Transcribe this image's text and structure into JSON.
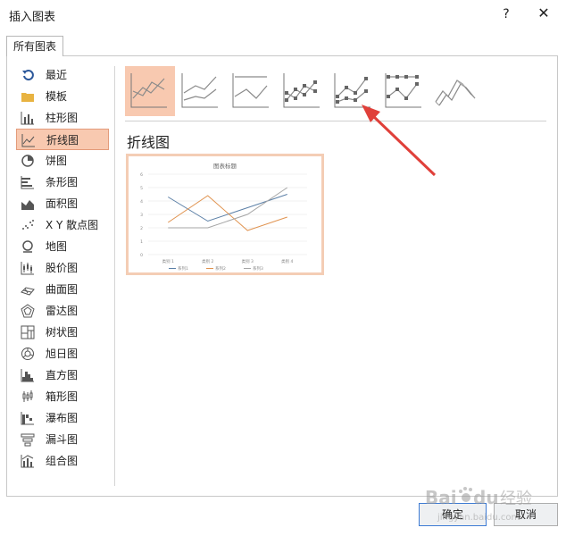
{
  "window": {
    "title": "插入图表",
    "help_label": "?",
    "close_label": "✕"
  },
  "tabs": [
    {
      "label": "所有图表",
      "active": true
    }
  ],
  "sidebar": {
    "items": [
      {
        "label": "最近",
        "icon": "recent-icon"
      },
      {
        "label": "模板",
        "icon": "folder-icon"
      },
      {
        "label": "柱形图",
        "icon": "column-chart-icon"
      },
      {
        "label": "折线图",
        "icon": "line-chart-icon",
        "selected": true
      },
      {
        "label": "饼图",
        "icon": "pie-chart-icon"
      },
      {
        "label": "条形图",
        "icon": "bar-chart-icon"
      },
      {
        "label": "面积图",
        "icon": "area-chart-icon"
      },
      {
        "label": "X Y 散点图",
        "icon": "scatter-chart-icon"
      },
      {
        "label": "地图",
        "icon": "map-chart-icon"
      },
      {
        "label": "股价图",
        "icon": "stock-chart-icon"
      },
      {
        "label": "曲面图",
        "icon": "surface-chart-icon"
      },
      {
        "label": "雷达图",
        "icon": "radar-chart-icon"
      },
      {
        "label": "树状图",
        "icon": "treemap-chart-icon"
      },
      {
        "label": "旭日图",
        "icon": "sunburst-chart-icon"
      },
      {
        "label": "直方图",
        "icon": "histogram-chart-icon"
      },
      {
        "label": "箱形图",
        "icon": "box-whisker-chart-icon"
      },
      {
        "label": "瀑布图",
        "icon": "waterfall-chart-icon"
      },
      {
        "label": "漏斗图",
        "icon": "funnel-chart-icon"
      },
      {
        "label": "组合图",
        "icon": "combo-chart-icon"
      }
    ]
  },
  "subtypes": [
    {
      "icon": "line-subtype-icon",
      "selected": true
    },
    {
      "icon": "stacked-line-subtype-icon"
    },
    {
      "icon": "percent-stacked-line-subtype-icon"
    },
    {
      "icon": "line-with-markers-subtype-icon"
    },
    {
      "icon": "stacked-line-with-markers-subtype-icon"
    },
    {
      "icon": "percent-stacked-line-with-markers-subtype-icon"
    },
    {
      "icon": "3d-line-subtype-icon"
    }
  ],
  "section_title": "折线图",
  "chart_data": {
    "type": "line",
    "title": "图表标题",
    "categories": [
      "类别 1",
      "类别 2",
      "类别 3",
      "类别 4"
    ],
    "series": [
      {
        "name": "系列1",
        "values": [
          4.3,
          2.5,
          3.5,
          4.5
        ],
        "color": "#5b7fa6"
      },
      {
        "name": "系列2",
        "values": [
          2.4,
          4.4,
          1.8,
          2.8
        ],
        "color": "#e0924e"
      },
      {
        "name": "系列3",
        "values": [
          2,
          2,
          3,
          5
        ],
        "color": "#a5a5a5"
      }
    ],
    "yticks": [
      "0",
      "1",
      "2",
      "3",
      "4",
      "5",
      "6"
    ],
    "ylim": [
      0,
      6
    ],
    "legend": "bottom",
    "grid": true
  },
  "buttons": {
    "ok": "确定",
    "cancel": "取消"
  },
  "colors": {
    "selected_bg": "#f8c9b0",
    "accent": "#e0924e",
    "ok_border": "#3d7bd4"
  },
  "watermark": {
    "brand": "Bai",
    "paw": "du",
    "sub": "经验",
    "url": "jingyan.baidu.com"
  }
}
